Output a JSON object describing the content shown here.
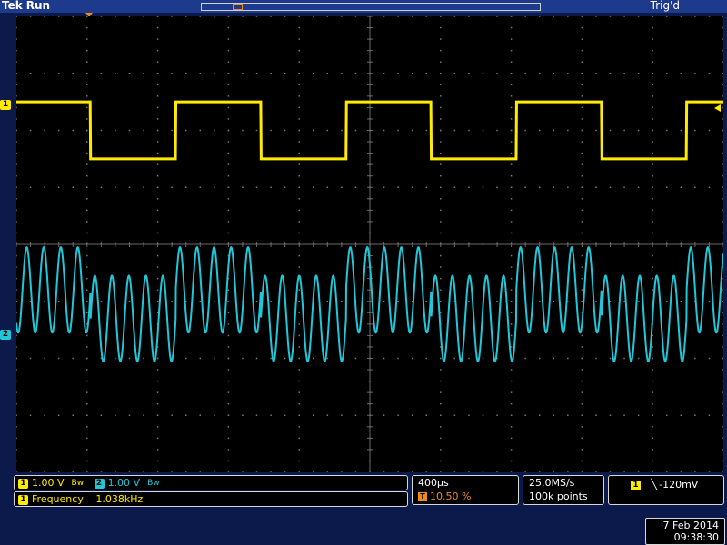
{
  "header": {
    "brand": "Tek",
    "run_state": "Run",
    "trigger_status": "Trig'd"
  },
  "markers": {
    "ch1": "1",
    "ch2": "2",
    "trigger_position": "T"
  },
  "channels": [
    {
      "number": "1",
      "scale": "1.00 V",
      "color": "#ffeb00"
    },
    {
      "number": "2",
      "scale": "1.00 V",
      "color": "#21c7d9"
    }
  ],
  "bandwidth_icon": "bw-limit-icon",
  "measurement": {
    "source": "1",
    "label": "Frequency",
    "value": "1.038kHz"
  },
  "timebase": {
    "scale": "400µs",
    "trigger_position": "10.50 %"
  },
  "acquisition": {
    "sample_rate": "25.0MS/s",
    "record_length": "100k points"
  },
  "trigger": {
    "source": "1",
    "slope_icon": "falling-edge-icon",
    "level": "-120mV"
  },
  "datetime": {
    "date": "7 Feb 2014",
    "time": "09:38:30"
  },
  "colors": {
    "ch1": "#ffeb00",
    "ch2": "#21c7d9",
    "trigger": "#f08a1c",
    "background": "#000000",
    "frame": "#0b1a4a"
  },
  "chart_data": {
    "type": "line",
    "grid": true,
    "divisions": {
      "x": 10,
      "y": 8
    },
    "series": [
      {
        "channel": "1",
        "shape": "square",
        "frequency_hz": 1038,
        "high_div": 2.5,
        "low_div": 1.5
      },
      {
        "channel": "2",
        "shape": "sine_with_step",
        "cycles_per_half_period": 5,
        "amplitude_div": 0.75
      }
    ]
  }
}
